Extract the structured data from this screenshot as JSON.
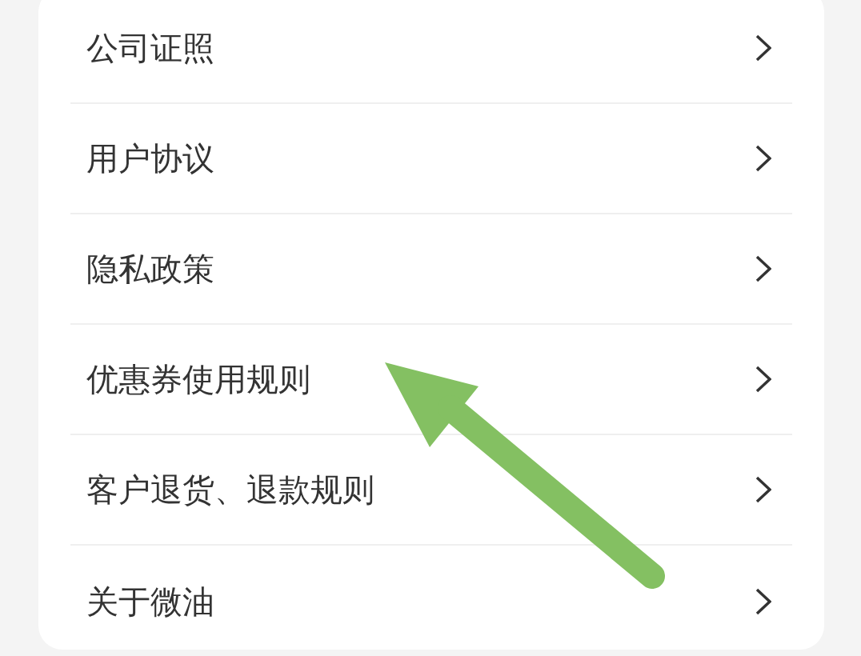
{
  "items": [
    {
      "label": "公司证照"
    },
    {
      "label": "用户协议"
    },
    {
      "label": "隐私政策"
    },
    {
      "label": "优惠券使用规则"
    },
    {
      "label": "客户退货、退款规则"
    },
    {
      "label": "关于微油"
    }
  ],
  "annotation": {
    "kind": "arrow"
  }
}
